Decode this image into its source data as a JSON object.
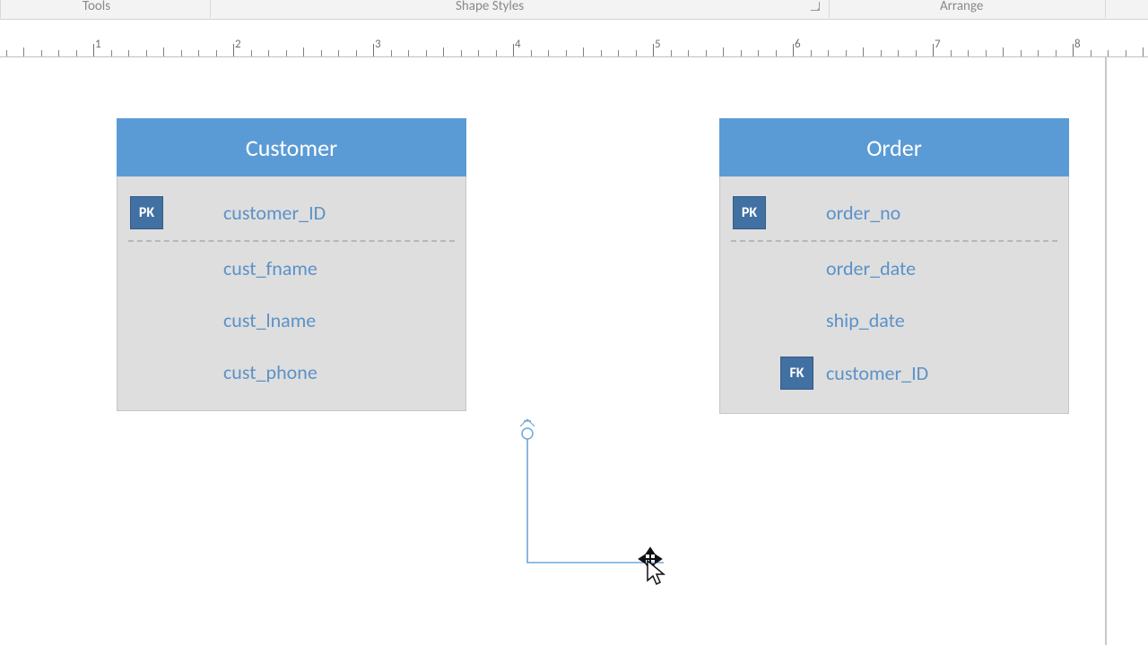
{
  "ribbon": {
    "groups": {
      "tools": "Tools",
      "shape_styles": "Shape Styles",
      "arrange": "Arrange"
    }
  },
  "ruler": {
    "labels": [
      "1",
      "2",
      "3",
      "4",
      "5",
      "6",
      "7",
      "8"
    ]
  },
  "entities": {
    "customer": {
      "title": "Customer",
      "pk_badge": "PK",
      "pk_field": "customer_ID",
      "fields": [
        "cust_fname",
        "cust_lname",
        "cust_phone"
      ]
    },
    "order": {
      "title": "Order",
      "pk_badge": "PK",
      "pk_field": "order_no",
      "fields": [
        "order_date",
        "ship_date"
      ],
      "fk_badge": "FK",
      "fk_field": "customer_ID"
    }
  }
}
